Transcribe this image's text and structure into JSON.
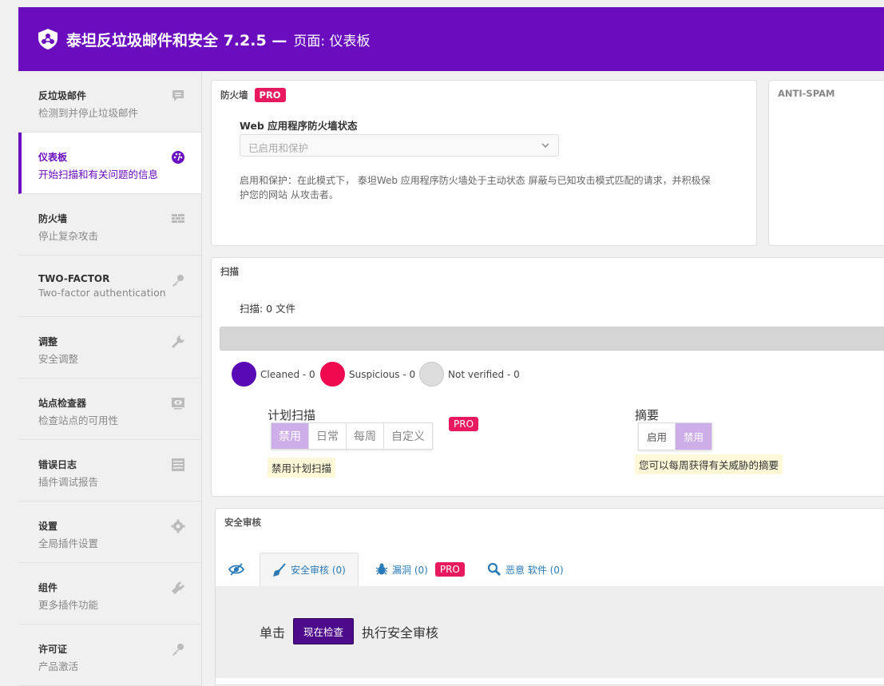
{
  "header": {
    "title": "泰坦反垃圾邮件和安全 7.2.5 —",
    "subtitle": "页面: 仪表板"
  },
  "sidebar": {
    "items": [
      {
        "name": "反垃圾邮件",
        "desc": "检测到并停止垃圾邮件",
        "icon": "comment-icon"
      },
      {
        "name": "仪表板",
        "desc": "开始扫描和有关问题的信息",
        "icon": "dashboard-icon"
      },
      {
        "name": "防火墙",
        "desc": "停止复杂攻击",
        "icon": "firewall-icon"
      },
      {
        "name": "TWO-FACTOR",
        "desc": "Two-factor authentication",
        "icon": "key-icon"
      },
      {
        "name": "调整",
        "desc": "安全调整",
        "icon": "wrench-icon"
      },
      {
        "name": "站点检查器",
        "desc": "检查站点的可用性",
        "icon": "visibility-icon"
      },
      {
        "name": "错误日志",
        "desc": "插件调试报告",
        "icon": "list-icon"
      },
      {
        "name": "设置",
        "desc": "全局插件设置",
        "icon": "gear-icon"
      },
      {
        "name": "组件",
        "desc": "更多插件功能",
        "icon": "plugin-icon"
      },
      {
        "name": "许可证",
        "desc": "产品激活",
        "icon": "key-icon"
      }
    ]
  },
  "firewall": {
    "title": "防火墙",
    "pro": "PRO",
    "label": "Web 应用程序防火墙状态",
    "select_value": "已启用和保护",
    "description": "启用和保护：在此模式下， 泰坦Web 应用程序防火墙处于主动状态 屏蔽与已知攻击模式匹配的请求，并积极保护您的网站 从攻击者。"
  },
  "antispam": {
    "title": "ANTI-SPAM"
  },
  "scan": {
    "title": "扫描",
    "count_text": "扫描: 0 文件",
    "progress": 0,
    "legend": [
      {
        "label": "Cleaned - 0",
        "color": "#5a0ab4"
      },
      {
        "label": "Suspicious - 0",
        "color": "#f0094f"
      },
      {
        "label": "Not verified - 0",
        "color": "#dddddd"
      }
    ],
    "schedule": {
      "title": "计划扫描",
      "options": [
        "禁用",
        "日常",
        "每周",
        "自定义"
      ],
      "selected": "禁用",
      "pro": "PRO",
      "note": "禁用计划扫描"
    },
    "digest": {
      "title": "摘要",
      "options": [
        "启用",
        "禁用"
      ],
      "selected": "禁用",
      "note": "您可以每周获得有关威胁的摘要"
    }
  },
  "audit": {
    "title": "安全审核",
    "tabs": [
      {
        "label": "安全审核 (0)",
        "icon": "broom-icon"
      },
      {
        "label": "漏洞 (0)",
        "icon": "bug-icon",
        "pro": "PRO"
      },
      {
        "label": "恶意 软件 (0)",
        "icon": "search-icon"
      }
    ],
    "prefix": "单击",
    "button": "现在检查",
    "suffix": "执行安全审核"
  },
  "colors": {
    "brand": "#6a0dbe",
    "pro": "#e8195f",
    "link": "#2a7ab8"
  }
}
